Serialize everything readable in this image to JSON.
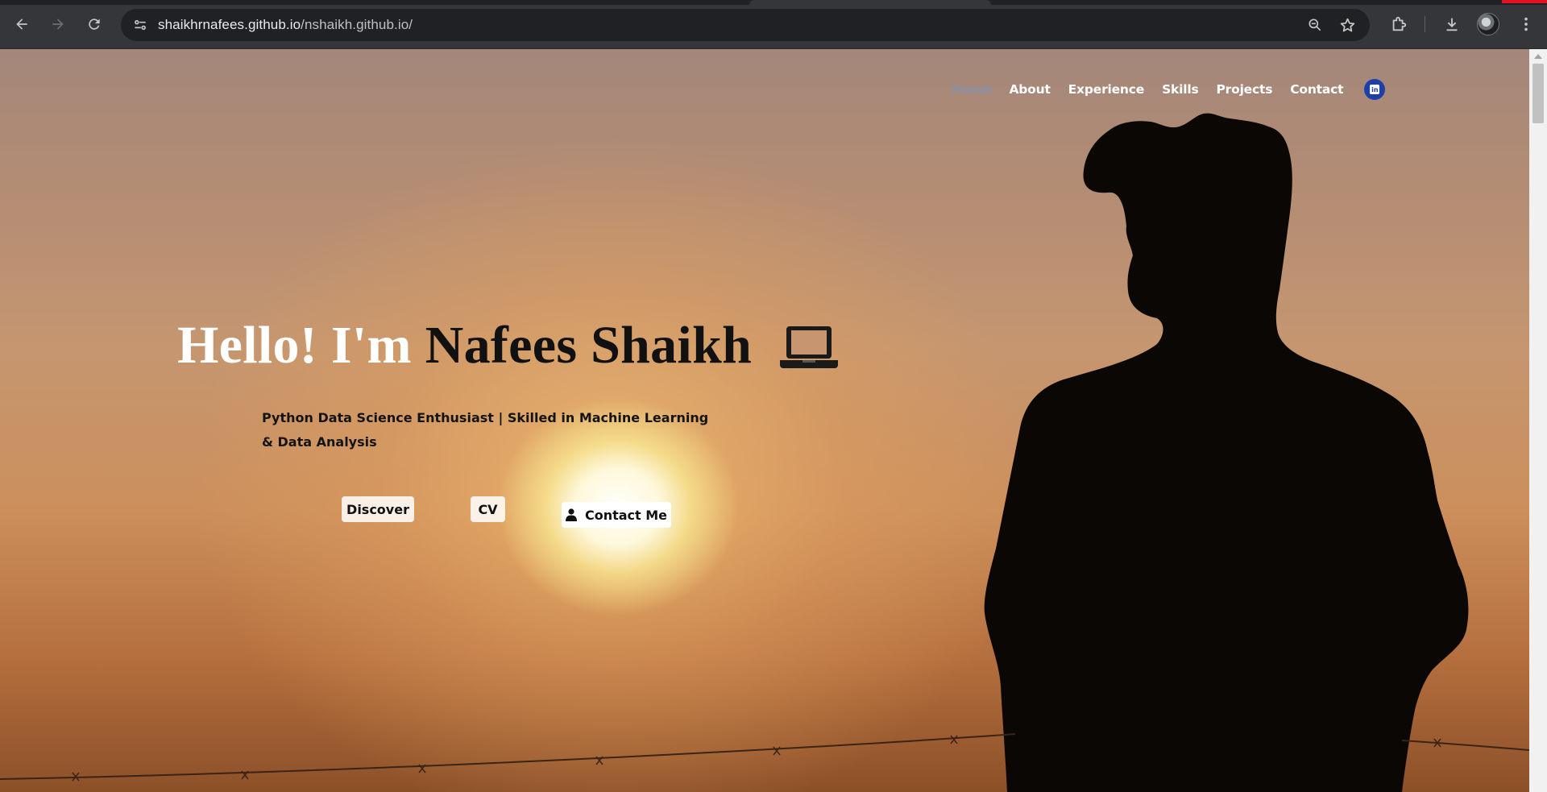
{
  "browser": {
    "url_host": "shaikhrnafees.github.io",
    "url_path": "/nshaikh.github.io/",
    "icons": [
      "back-icon",
      "forward-icon",
      "reload-icon",
      "site-info-icon",
      "zoom-icon",
      "bookmark-star-icon",
      "extensions-icon",
      "download-icon",
      "profile-avatar",
      "menu-icon"
    ]
  },
  "nav": {
    "items": [
      {
        "label": "Home",
        "active": true
      },
      {
        "label": "About"
      },
      {
        "label": "Experience"
      },
      {
        "label": "Skills"
      },
      {
        "label": "Projects"
      },
      {
        "label": "Contact"
      }
    ],
    "social_icon": "linkedin-icon"
  },
  "hero": {
    "greeting": "Hello! I'm",
    "name": "Nafees Shaikh",
    "tagline": "Python Data Science Enthusiast | Skilled in Machine Learning & Data Analysis",
    "icon": "laptop-icon"
  },
  "buttons": {
    "discover": "Discover",
    "cv": "CV",
    "contact": "Contact Me",
    "contact_icon": "person-icon"
  },
  "colors": {
    "nav_active": "#8a8fa8",
    "linkedin": "#1f3ea8",
    "chrome_bg": "#35363a"
  }
}
